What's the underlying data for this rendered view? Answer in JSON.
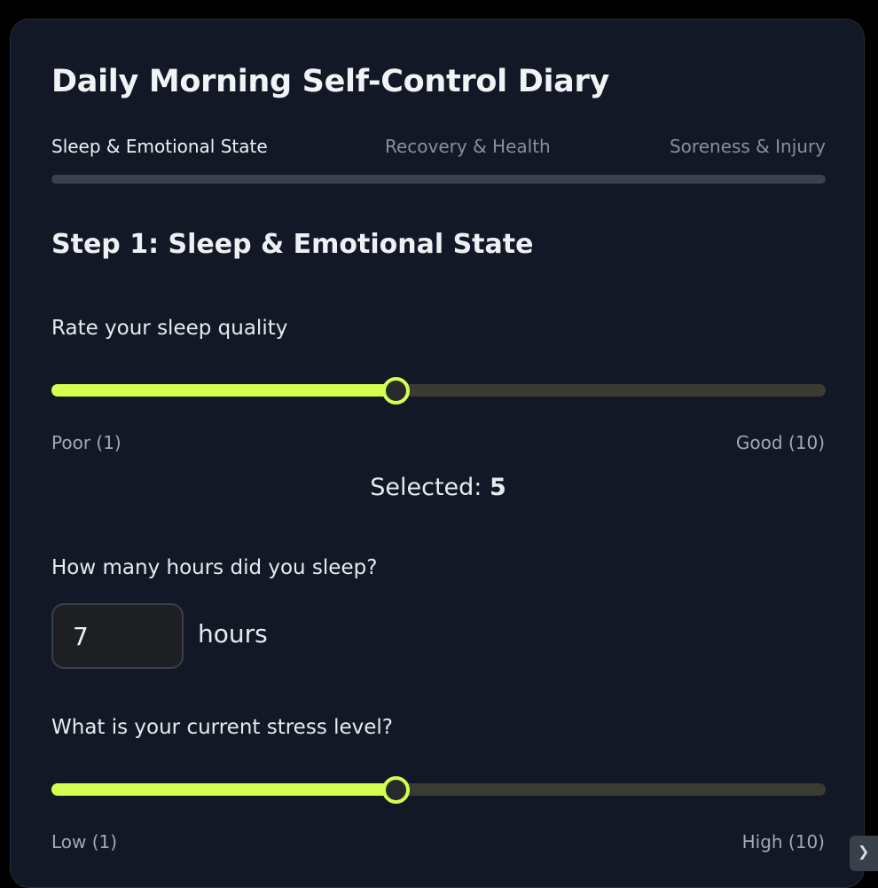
{
  "title": "Daily Morning Self-Control Diary",
  "steps": [
    {
      "label": "Sleep & Emotional State",
      "active": true
    },
    {
      "label": "Recovery & Health",
      "active": false
    },
    {
      "label": "Soreness & Injury",
      "active": false
    }
  ],
  "progress_fraction": 0.0,
  "step_heading": "Step 1: Sleep & Emotional State",
  "sleep_quality": {
    "label": "Rate your sleep quality",
    "min": 1,
    "max": 10,
    "value": 5,
    "min_label": "Poor (1)",
    "max_label": "Good (10)",
    "selected_prefix": "Selected: ",
    "selected_value": "5"
  },
  "sleep_hours": {
    "label": "How many hours did you sleep?",
    "value": "7",
    "unit": "hours"
  },
  "stress_level": {
    "label": "What is your current stress level?",
    "min": 1,
    "max": 10,
    "value": 5,
    "min_label": "Low (1)",
    "max_label": "High (10)"
  },
  "colors": {
    "accent": "#d4ff50",
    "card_bg": "#121826",
    "page_bg": "#000000"
  },
  "corner_widget_icon": "chevron-right-icon"
}
